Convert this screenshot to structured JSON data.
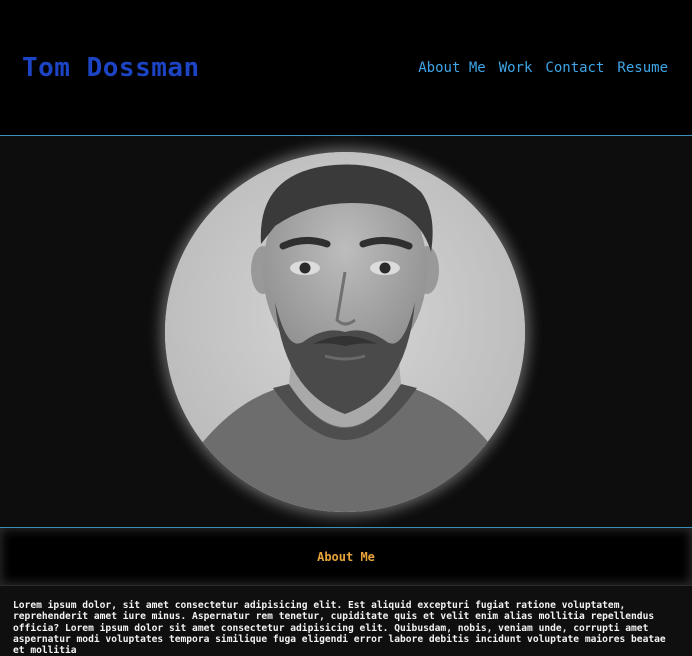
{
  "header": {
    "title": "Tom Dossman",
    "nav": [
      {
        "label": "About Me"
      },
      {
        "label": "Work"
      },
      {
        "label": "Contact"
      },
      {
        "label": "Resume"
      }
    ]
  },
  "hero": {
    "photo_icon": "portrait-photo"
  },
  "about": {
    "heading": "About Me",
    "body": "Lorem ipsum dolor, sit amet consectetur adipisicing elit. Est aliquid excepturi fugiat ratione voluptatem, reprehenderit amet iure minus. Aspernatur rem tenetur, cupiditate quis et velit enim alias mollitia repellendus officia? Lorem ipsum dolor sit amet consectetur adipisicing elit. Quibusdam, nobis, veniam unde, corrupti amet aspernatur modi voluptates tempora similique fuga eligendi error labore debitis incidunt voluptate maiores beatae et mollitia"
  },
  "colors": {
    "title": "#1c44c4",
    "nav_link": "#3ea6e6",
    "about_heading": "#e8a33a",
    "divider": "#3a8fb7"
  }
}
